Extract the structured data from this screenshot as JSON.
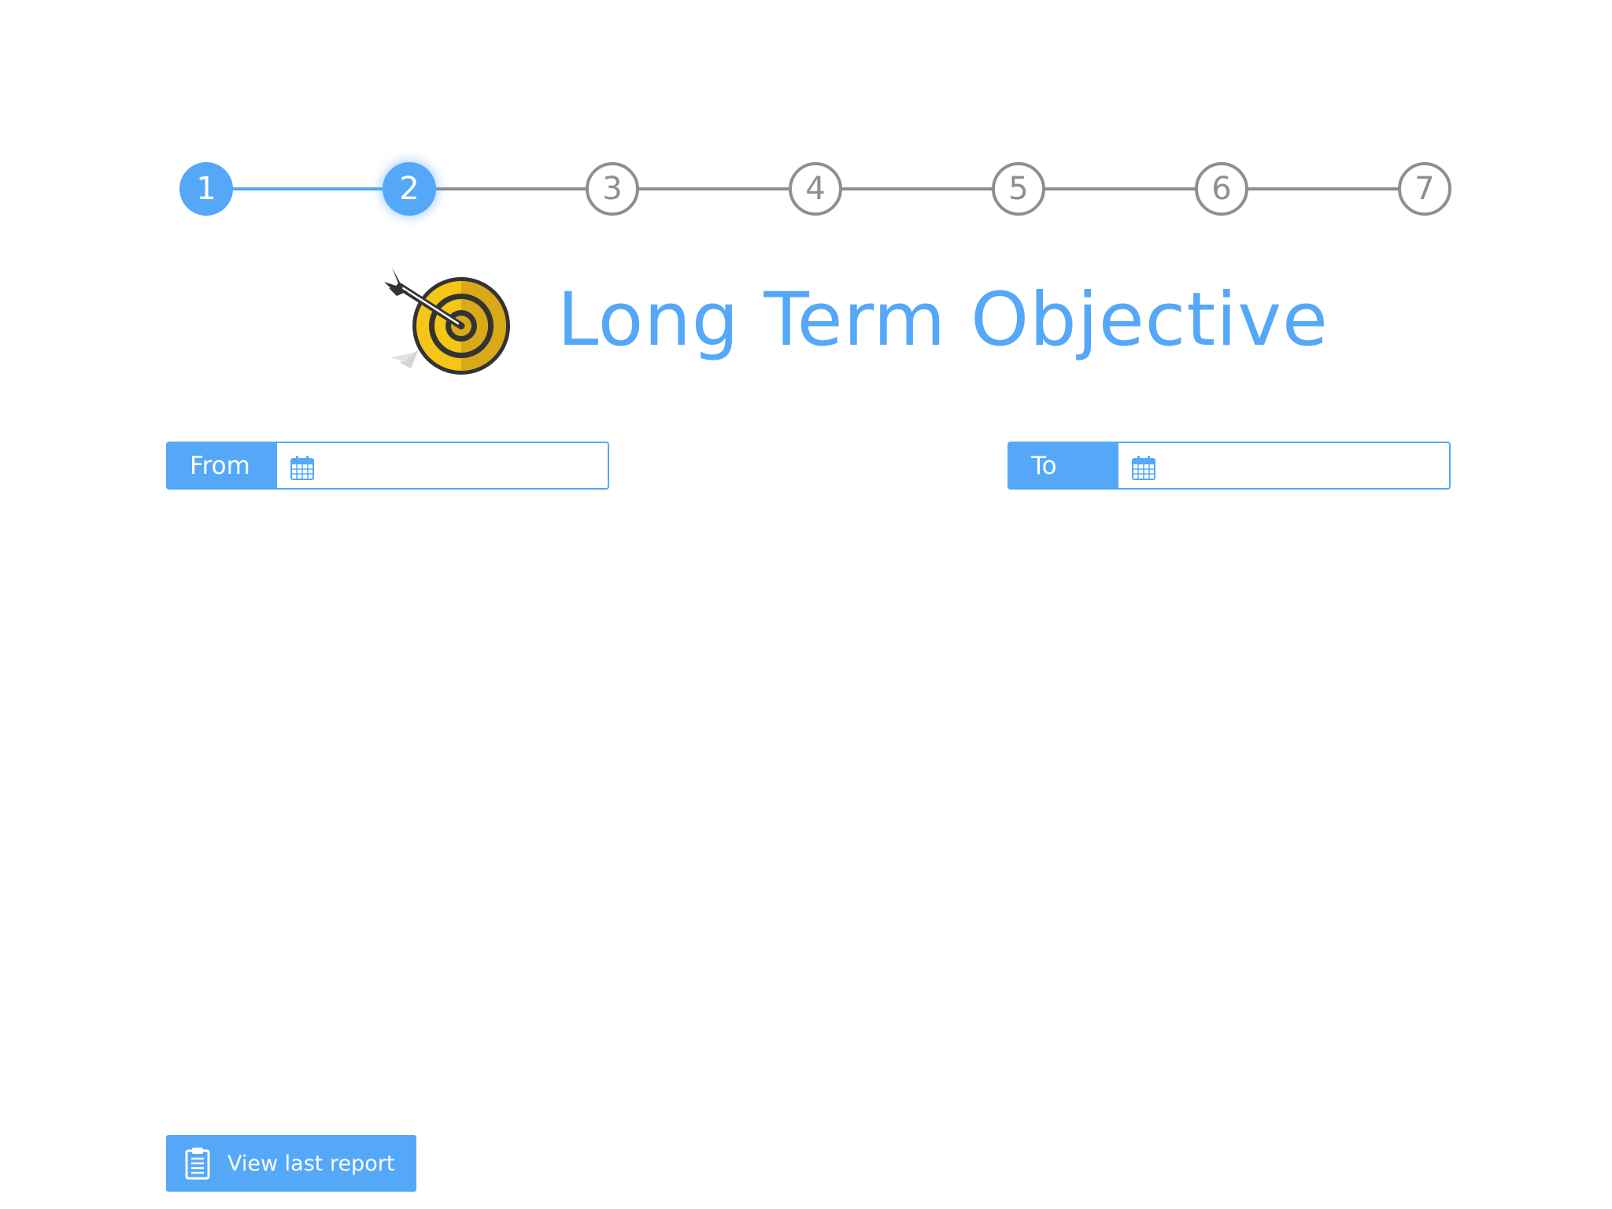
{
  "stepper": {
    "steps": [
      {
        "label": "1",
        "state": "done"
      },
      {
        "label": "2",
        "state": "current"
      },
      {
        "label": "3",
        "state": "todo"
      },
      {
        "label": "4",
        "state": "todo"
      },
      {
        "label": "5",
        "state": "todo"
      },
      {
        "label": "6",
        "state": "todo"
      },
      {
        "label": "7",
        "state": "todo"
      }
    ]
  },
  "header": {
    "icon": "target-icon",
    "title": "Long Term Objective"
  },
  "dates": {
    "from": {
      "label": "From",
      "value": "",
      "icon": "calendar-icon"
    },
    "to": {
      "label": "To",
      "value": "",
      "icon": "calendar-icon"
    }
  },
  "footer": {
    "report_button": {
      "label": "View last report",
      "icon": "clipboard-icon"
    }
  },
  "colors": {
    "accent": "#55a8f8",
    "inactive": "#8f8f8f",
    "target_yellow": "#f5c518",
    "target_dark": "#333333"
  }
}
